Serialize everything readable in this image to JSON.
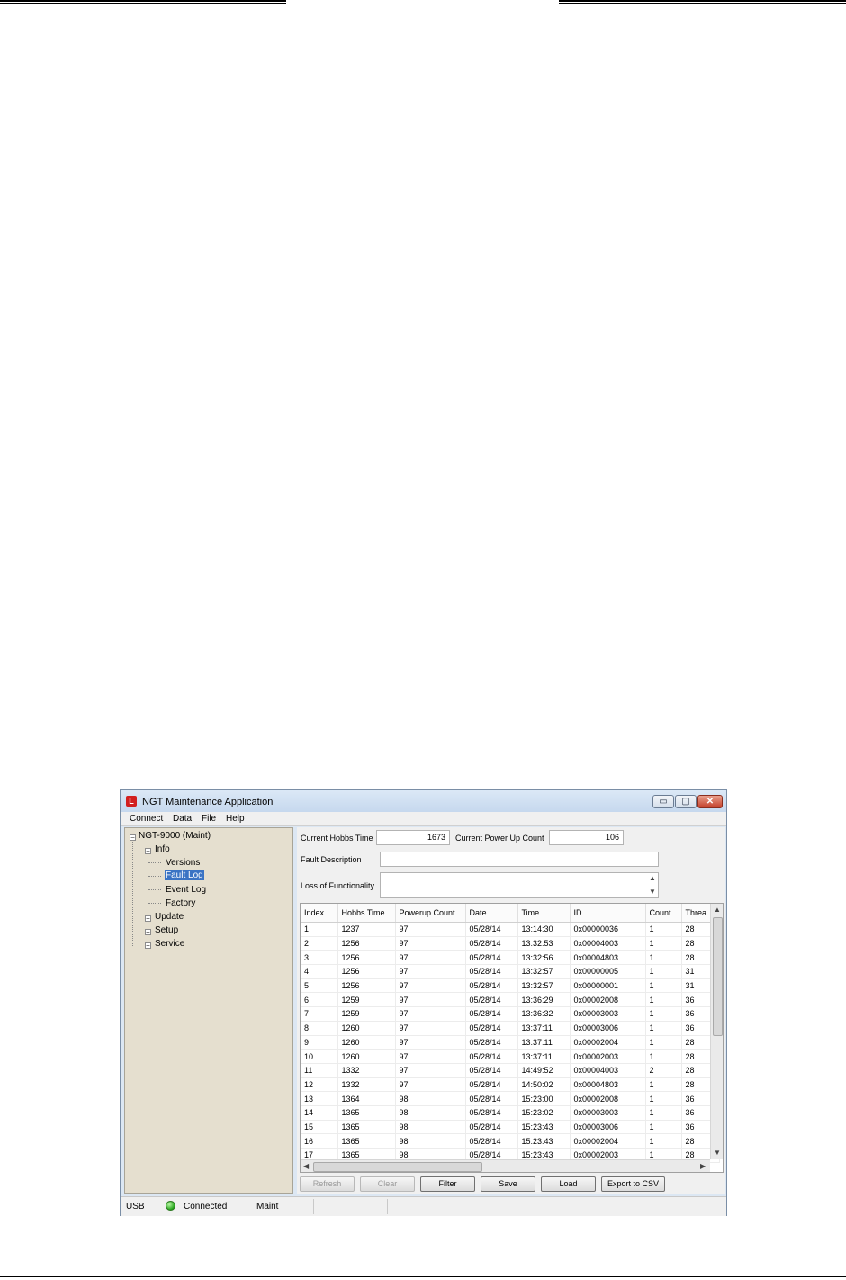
{
  "window": {
    "title": "NGT Maintenance Application",
    "controls": {
      "minimize": "▭",
      "maximize": "▢",
      "close": "✕"
    }
  },
  "menu": [
    "Connect",
    "Data",
    "File",
    "Help"
  ],
  "tree": {
    "root": "NGT-9000 (Maint)",
    "info": "Info",
    "versions": "Versions",
    "fault_log": "Fault Log",
    "event_log": "Event Log",
    "factory": "Factory",
    "update": "Update",
    "setup": "Setup",
    "service": "Service"
  },
  "fields": {
    "hobbs_label": "Current Hobbs Time",
    "hobbs_value": "1673",
    "powerup_label": "Current Power Up Count",
    "powerup_value": "106",
    "fault_desc_label": "Fault Description",
    "fault_desc_value": "",
    "loss_label": "Loss of Functionality",
    "loss_value": ""
  },
  "table": {
    "columns": [
      "Index",
      "Hobbs Time",
      "Powerup Count",
      "Date",
      "Time",
      "ID",
      "Count",
      "Threa"
    ],
    "rows": [
      [
        "1",
        "1237",
        "97",
        "05/28/14",
        "13:14:30",
        "0x00000036",
        "1",
        "28"
      ],
      [
        "2",
        "1256",
        "97",
        "05/28/14",
        "13:32:53",
        "0x00004003",
        "1",
        "28"
      ],
      [
        "3",
        "1256",
        "97",
        "05/28/14",
        "13:32:56",
        "0x00004803",
        "1",
        "28"
      ],
      [
        "4",
        "1256",
        "97",
        "05/28/14",
        "13:32:57",
        "0x00000005",
        "1",
        "31"
      ],
      [
        "5",
        "1256",
        "97",
        "05/28/14",
        "13:32:57",
        "0x00000001",
        "1",
        "31"
      ],
      [
        "6",
        "1259",
        "97",
        "05/28/14",
        "13:36:29",
        "0x00002008",
        "1",
        "36"
      ],
      [
        "7",
        "1259",
        "97",
        "05/28/14",
        "13:36:32",
        "0x00003003",
        "1",
        "36"
      ],
      [
        "8",
        "1260",
        "97",
        "05/28/14",
        "13:37:11",
        "0x00003006",
        "1",
        "36"
      ],
      [
        "9",
        "1260",
        "97",
        "05/28/14",
        "13:37:11",
        "0x00002004",
        "1",
        "28"
      ],
      [
        "10",
        "1260",
        "97",
        "05/28/14",
        "13:37:11",
        "0x00002003",
        "1",
        "28"
      ],
      [
        "11",
        "1332",
        "97",
        "05/28/14",
        "14:49:52",
        "0x00004003",
        "2",
        "28"
      ],
      [
        "12",
        "1332",
        "97",
        "05/28/14",
        "14:50:02",
        "0x00004803",
        "1",
        "28"
      ],
      [
        "13",
        "1364",
        "98",
        "05/28/14",
        "15:23:00",
        "0x00002008",
        "1",
        "36"
      ],
      [
        "14",
        "1365",
        "98",
        "05/28/14",
        "15:23:02",
        "0x00003003",
        "1",
        "36"
      ],
      [
        "15",
        "1365",
        "98",
        "05/28/14",
        "15:23:43",
        "0x00003006",
        "1",
        "36"
      ],
      [
        "16",
        "1365",
        "98",
        "05/28/14",
        "15:23:43",
        "0x00002004",
        "1",
        "28"
      ],
      [
        "17",
        "1365",
        "98",
        "05/28/14",
        "15:23:43",
        "0x00002003",
        "1",
        "28"
      ]
    ]
  },
  "buttons": {
    "refresh": "Refresh",
    "clear": "Clear",
    "filter": "Filter",
    "save": "Save",
    "load": "Load",
    "export": "Export to CSV"
  },
  "status": {
    "port": "USB",
    "connection": "Connected",
    "mode": "Maint",
    "led_color": "#25a51c"
  },
  "colors": {
    "selection": "#3a73c4",
    "tree_background": "#e5dfcf"
  }
}
